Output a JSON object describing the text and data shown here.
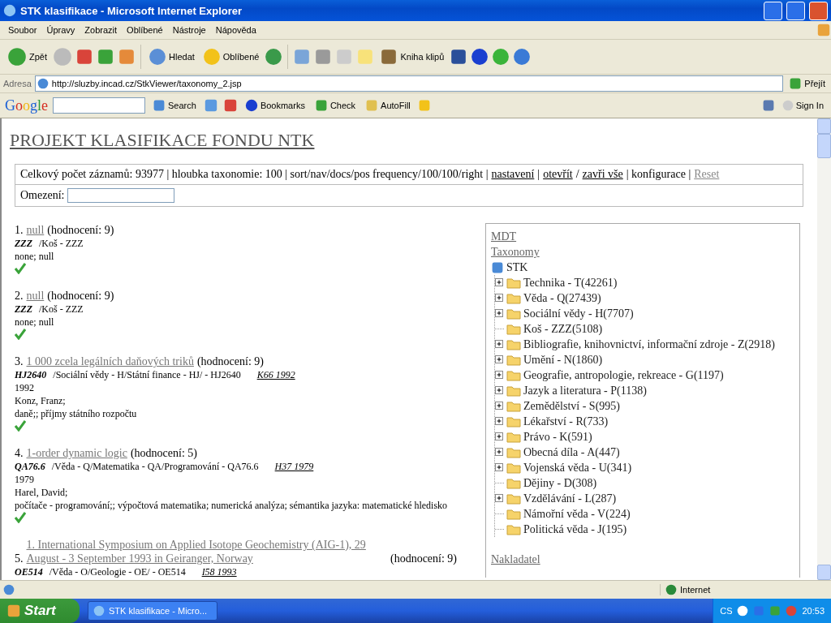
{
  "window": {
    "title": "STK klasifikace - Microsoft Internet Explorer"
  },
  "menu": [
    "Soubor",
    "Úpravy",
    "Zobrazit",
    "Oblíbené",
    "Nástroje",
    "Nápověda"
  ],
  "toolbar": {
    "back": "Zpět",
    "search": "Hledat",
    "favorites": "Oblíbené",
    "clipbook": "Kniha klipů"
  },
  "address": {
    "label": "Adresa",
    "url": "http://sluzby.incad.cz/StkViewer/taxonomy_2.jsp",
    "go": "Přejít"
  },
  "google_bar": {
    "logo": "Google",
    "search": "Search",
    "bookmarks": "Bookmarks",
    "check": "Check",
    "autofill": "AutoFill",
    "sign_in": "Sign In"
  },
  "page": {
    "heading": "PROJEKT KLASIFIKACE FONDU NTK",
    "info": [
      {
        "kind": "text",
        "text": "Celkový počet záznamů: 93977 | hloubka taxonomie: 100 | sort/nav/docs/pos frequency/100/100/right |"
      },
      {
        "kind": "link",
        "text": "nastavení"
      },
      {
        "kind": "text",
        "text": "|"
      },
      {
        "kind": "link",
        "text": "otevřít"
      },
      {
        "kind": "text",
        "text": "/"
      },
      {
        "kind": "link",
        "text": "zavři vše"
      },
      {
        "kind": "text",
        "text": "| konfigurace |"
      },
      {
        "kind": "muted-link",
        "text": "Reset"
      }
    ],
    "filter": {
      "label": "Omezení:"
    },
    "records": [
      {
        "number": "1.",
        "title": "null",
        "rating": "(hodnocení: 9)",
        "code": "ZZZ",
        "path": "/Koš - ZZZ",
        "lines": [
          "none; null"
        ],
        "approved": true
      },
      {
        "number": "2.",
        "title": "null",
        "rating": "(hodnocení: 9)",
        "code": "ZZZ",
        "path": "/Koš - ZZZ",
        "lines": [
          "none; null"
        ],
        "approved": true
      },
      {
        "number": "3.",
        "title": "1 000 zcela legálních daňových triků",
        "rating": "(hodnocení: 9)",
        "code": "HJ2640",
        "path": "/Sociální vědy - H/Státní finance - HJ/ - HJ2640",
        "call_number": "K66 1992",
        "lines": [
          "1992",
          "Konz, Franz;",
          "daně;; příjmy státního rozpočtu"
        ],
        "approved": true
      },
      {
        "number": "4.",
        "title": "1-order dynamic logic",
        "rating": "(hodnocení: 5)",
        "code": "QA76.6",
        "path": "/Věda - Q/Matematika - QA/Programování - QA76.6",
        "call_number": "H37 1979",
        "lines": [
          "1979",
          "Harel, David;",
          "počítače - programování;; výpočtová matematika; numerická analýza; sémantika jazyka: matematické hledisko"
        ],
        "approved": true
      },
      {
        "number": "5.",
        "title": "1. International Symposium on Applied Isotope Geochemistry (AIG-1), 29 August - 3 September 1993 in Geiranger, Norway",
        "rating": "(hodnocení: 9)",
        "code": "OE514",
        "path": "/Věda - O/Geologie - OE/ - OE514",
        "call_number": "I58 1993"
      }
    ],
    "side_panel": {
      "links_top": [
        "MDT",
        "Taxonomy"
      ],
      "root": "STK",
      "tree": [
        {
          "label": "Technika - T(42261)",
          "has_children": true
        },
        {
          "label": "Věda - Q(27439)",
          "has_children": true
        },
        {
          "label": "Sociální vědy - H(7707)",
          "has_children": true
        },
        {
          "label": "Koš - ZZZ(5108)",
          "has_children": false
        },
        {
          "label": "Bibliografie, knihovnictví, informační zdroje - Z(2918)",
          "has_children": true
        },
        {
          "label": "Umění - N(1860)",
          "has_children": true
        },
        {
          "label": "Geografie, antropologie, rekreace - G(1197)",
          "has_children": true
        },
        {
          "label": "Jazyk a literatura - P(1138)",
          "has_children": true
        },
        {
          "label": "Zemědělství - S(995)",
          "has_children": true
        },
        {
          "label": "Lékařství - R(733)",
          "has_children": true
        },
        {
          "label": "Právo - K(591)",
          "has_children": true
        },
        {
          "label": "Obecná díla - A(447)",
          "has_children": true
        },
        {
          "label": "Vojenská věda - U(341)",
          "has_children": true
        },
        {
          "label": "Dějiny - D(308)",
          "has_children": false
        },
        {
          "label": "Vzdělávání - L(287)",
          "has_children": true
        },
        {
          "label": "Námořní věda - V(224)",
          "has_children": false
        },
        {
          "label": "Politická věda - J(195)",
          "has_children": false
        }
      ],
      "links_bottom": [
        "Nakladatel"
      ]
    }
  },
  "status_bar": {
    "zone": "Internet"
  },
  "taskbar": {
    "start": "Start",
    "task": "STK klasifikace - Micro...",
    "language": "CS",
    "clock": "20:53"
  }
}
